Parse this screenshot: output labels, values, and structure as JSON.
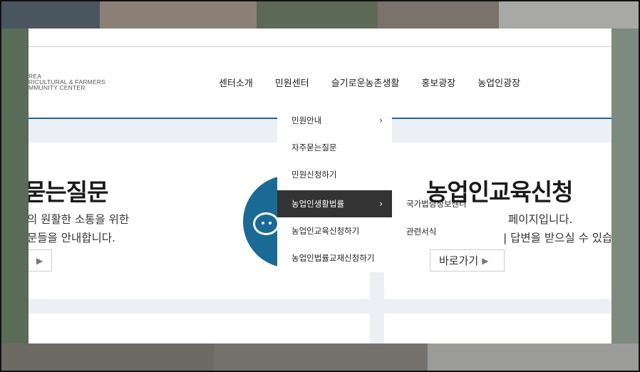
{
  "header": {
    "logo_lines": [
      "REA",
      "RICULTURAL & FARMERS",
      "MMUNITY CENTER"
    ],
    "nav": [
      "센터소개",
      "민원센터",
      "슬기로운농촌생활",
      "홍보광장",
      "농업인광장"
    ]
  },
  "left_card": {
    "title": "묻는질문",
    "lines": [
      "의 원활한 소통을 위한",
      "문들을 안내합니다."
    ],
    "button_arrow": "▶"
  },
  "right_card": {
    "title": "농업인교육신청",
    "lines": [
      "페이지입니다.",
      "| 답변을 받으실 수 있습"
    ],
    "button_label": "바로가기",
    "button_arrow": "▶"
  },
  "dropdown": {
    "items": [
      "민원안내",
      "자주묻는질문",
      "민원신청하기",
      "농업인생활법률",
      "농업인교육신청하기",
      "농업인법률교재신청하기"
    ],
    "chevron": "›",
    "active_index": 3,
    "submenu": [
      "국가법령정보센터",
      "관련서식"
    ]
  },
  "colors": {
    "accent": "#1b6a96",
    "active_bg": "#333333"
  }
}
